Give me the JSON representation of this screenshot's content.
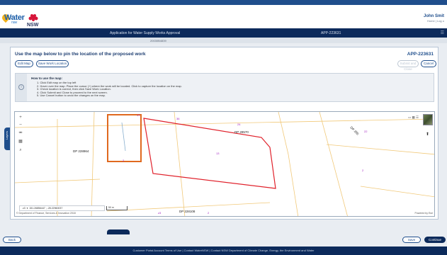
{
  "header": {
    "logo_text": "Water",
    "logo_sub": "nsw",
    "nsw_text": "NSW",
    "user_name": "John Smit",
    "user_links": "Home | Log o"
  },
  "appbar": {
    "title": "Application for Water Supply Works Approval",
    "reference": "APP-223631",
    "sub_reference": "20030B4839"
  },
  "panel": {
    "title": "Use the map below to pin the location of the proposed work",
    "reference": "APP-223631",
    "edit_map_label": "Edit Map",
    "save_location_label": "Save Work Location",
    "submit_close_label": "Submit and Close",
    "cancel_label": "Cancel"
  },
  "howto": {
    "title": "How to use the map:",
    "steps": [
      "1. Click Edit map on the top left",
      "2. Hover over the map. Place the cursor (+) where the work will be located. Click to capture the location on the map.",
      "3. Check location is correct, then click Save Work Location.",
      "4. Click Submit and Close to proceed to the next screen.",
      "5. Use Cancel button to undo the changes on the map."
    ]
  },
  "map": {
    "lot_labels": [
      "17",
      "36",
      "24",
      "22",
      "13",
      "2",
      "z3",
      "2",
      "2"
    ],
    "dp_labels": [
      "DP 28570",
      "DP 228964",
      "DP 228108",
      "DP 285"
    ],
    "coordinate_zone": "z3",
    "coordinate_value": "151.26856447 ; -28.22960037",
    "scale_label": "50 m",
    "copyright": "© Department of Finance, Services & Innovation 2018",
    "powered_by": "Powered by Esri"
  },
  "sidetab_label": "Layers",
  "footer_actions": {
    "back_label": "Back",
    "save_label": "Save",
    "continue_label": "Continue"
  },
  "footer_text": "Customer Portal Account  Terms of Use  |  Contact WaterNSW  |  Contact NSW Department of Climate Change, Energy, the Environment and Water",
  "colors": {
    "primary": "#1f4e8c",
    "navy": "#0c2a5b",
    "parcel_red": "#e0202a",
    "marker_orange": "#e0691f"
  }
}
